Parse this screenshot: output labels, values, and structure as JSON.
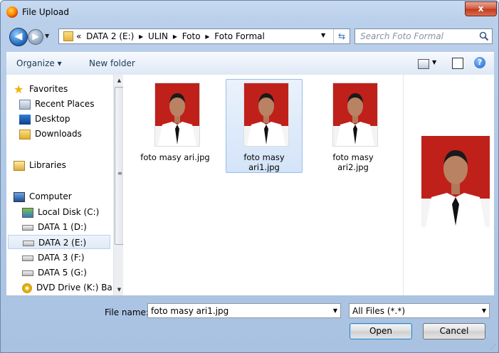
{
  "window": {
    "title": "File Upload",
    "close_label": "x"
  },
  "address_bar": {
    "crumbs": [
      "«",
      "DATA 2 (E:)",
      "▸",
      "ULIN",
      "▸",
      "Foto",
      "▸",
      "Foto Formal"
    ],
    "search_placeholder": "Search Foto Formal"
  },
  "toolbar": {
    "organize": "Organize ▾",
    "new_folder": "New folder"
  },
  "nav": {
    "favorites": "Favorites",
    "recent": "Recent Places",
    "desktop": "Desktop",
    "downloads": "Downloads",
    "libraries": "Libraries",
    "computer": "Computer",
    "local_c": "Local Disk (C:)",
    "data1": "DATA 1 (D:)",
    "data2": "DATA 2 (E:)",
    "data3": "DATA 3 (F:)",
    "data5": "DATA  5 (G:)",
    "dvd": "DVD Drive (K:) Ba"
  },
  "files": [
    {
      "name_line1": "foto masy ari.jpg",
      "name_line2": ""
    },
    {
      "name_line1": "foto masy",
      "name_line2": "ari1.jpg"
    },
    {
      "name_line1": "foto masy",
      "name_line2": "ari2.jpg"
    }
  ],
  "footer": {
    "file_name_label": "File name:",
    "file_name_value": "foto masy ari1.jpg",
    "file_type": "All Files (*.*)",
    "open": "Open",
    "cancel": "Cancel"
  },
  "colors": {
    "accent": "#3c7fb1",
    "selection": "#d4e4f8",
    "photo_bg": "#c0201a"
  }
}
